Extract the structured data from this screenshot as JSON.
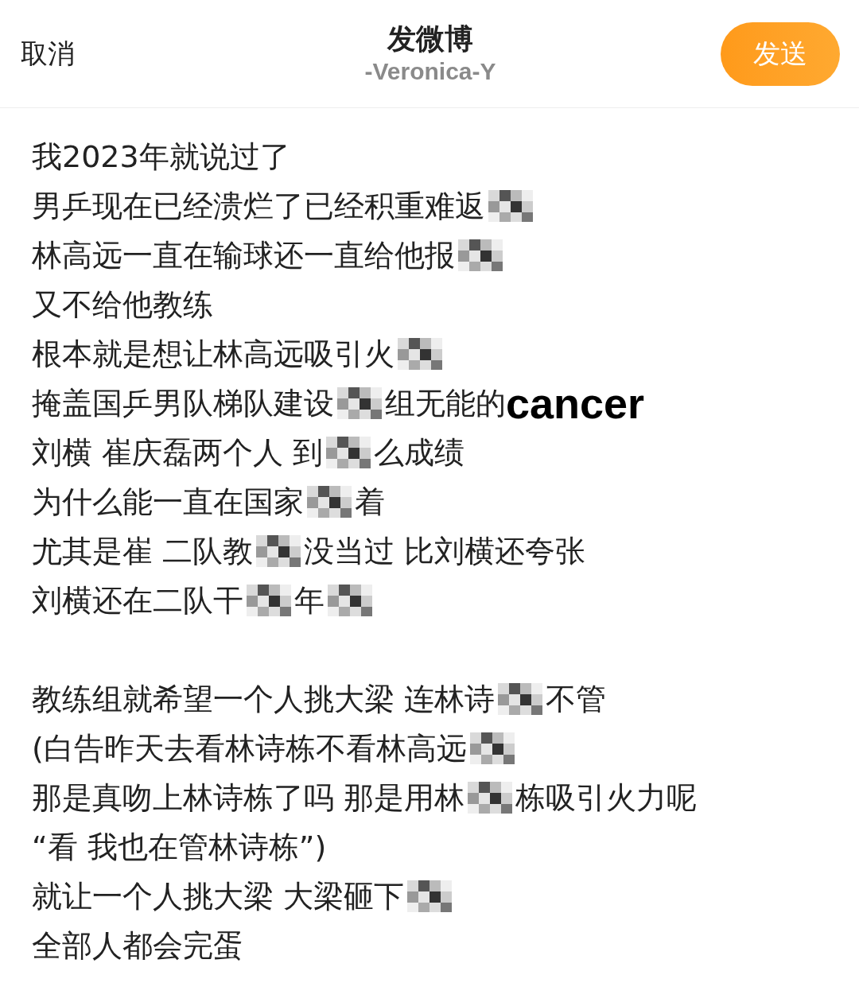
{
  "header": {
    "cancel": "取消",
    "title": "发微博",
    "subtitle": "-Veronica-Y",
    "send": "发送"
  },
  "paragraphs": [
    {
      "lines": [
        {
          "segments": [
            {
              "kind": "text",
              "text": "我2023年就说过了"
            }
          ]
        },
        {
          "segments": [
            {
              "kind": "text",
              "text": "男乒现在已经溃烂了已经积重难返"
            },
            {
              "kind": "mosaic"
            }
          ]
        },
        {
          "segments": [
            {
              "kind": "text",
              "text": "林高远一直在输球还一直给他报"
            },
            {
              "kind": "mosaic"
            }
          ]
        },
        {
          "segments": [
            {
              "kind": "text",
              "text": "又不给他教练"
            }
          ]
        },
        {
          "segments": [
            {
              "kind": "text",
              "text": "根本就是想让林高远吸引火"
            },
            {
              "kind": "mosaic"
            }
          ]
        },
        {
          "segments": [
            {
              "kind": "text",
              "text": "掩盖国乒男队梯队建设"
            },
            {
              "kind": "mosaic"
            },
            {
              "kind": "text",
              "text": "组无能的"
            },
            {
              "kind": "large",
              "text": "cancer"
            }
          ]
        },
        {
          "segments": [
            {
              "kind": "text",
              "text": "刘横 崔庆磊两个人 到"
            },
            {
              "kind": "mosaic"
            },
            {
              "kind": "text",
              "text": "么成绩"
            }
          ]
        },
        {
          "segments": [
            {
              "kind": "text",
              "text": "为什么能一直在国家"
            },
            {
              "kind": "mosaic"
            },
            {
              "kind": "text",
              "text": "着"
            }
          ]
        },
        {
          "segments": [
            {
              "kind": "text",
              "text": "尤其是崔 二队教"
            },
            {
              "kind": "mosaic"
            },
            {
              "kind": "text",
              "text": "没当过 比刘横还夸张"
            }
          ]
        },
        {
          "segments": [
            {
              "kind": "text",
              "text": "刘横还在二队干"
            },
            {
              "kind": "mosaic"
            },
            {
              "kind": "text",
              "text": "年"
            },
            {
              "kind": "mosaic"
            }
          ]
        }
      ]
    },
    {
      "lines": [
        {
          "segments": [
            {
              "kind": "text",
              "text": "教练组就希望一个人挑大梁 连林诗"
            },
            {
              "kind": "mosaic"
            },
            {
              "kind": "text",
              "text": "不管"
            }
          ]
        },
        {
          "segments": [
            {
              "kind": "text",
              "text": "(白告昨天去看林诗栋不看林高远"
            },
            {
              "kind": "mosaic"
            }
          ]
        },
        {
          "segments": [
            {
              "kind": "text",
              "text": "那是真吻上林诗栋了吗 那是用林"
            },
            {
              "kind": "mosaic"
            },
            {
              "kind": "text",
              "text": "栋吸引火力呢"
            }
          ]
        },
        {
          "segments": [
            {
              "kind": "text",
              "text": "“看 我也在管林诗栋”)"
            }
          ]
        },
        {
          "segments": [
            {
              "kind": "text",
              "text": "就让一个人挑大梁 大梁砸下"
            },
            {
              "kind": "mosaic"
            }
          ]
        },
        {
          "segments": [
            {
              "kind": "text",
              "text": "全部人都会完蛋"
            }
          ]
        }
      ]
    }
  ]
}
